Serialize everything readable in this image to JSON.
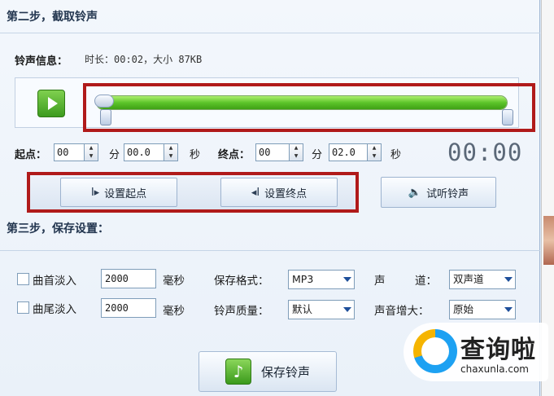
{
  "step2": {
    "title": "第二步，截取铃声",
    "info_label": "铃声信息：",
    "info_value": "时长：00:02，大小 87KB",
    "range_progress": 1.0
  },
  "time": {
    "start_label": "起点：",
    "start_min": "00",
    "start_min_unit": "分",
    "start_sec": "00.0",
    "start_sec_unit": "秒",
    "end_label": "终点：",
    "end_min": "00",
    "end_min_unit": "分",
    "end_sec": "02.0",
    "end_sec_unit": "秒",
    "display": "00:00"
  },
  "buttons": {
    "set_start": "设置起点",
    "set_end": "设置终点",
    "preview": "试听铃声",
    "save": "保存铃声"
  },
  "step3": {
    "title": "第三步，保存设置：",
    "fade_in_label": "曲首淡入",
    "fade_in_value": "2000",
    "fade_in_unit": "毫秒",
    "fade_out_label": "曲尾淡入",
    "fade_out_value": "2000",
    "fade_out_unit": "毫秒",
    "format_label": "保存格式：",
    "format_value": "MP3",
    "quality_label": "铃声质量：",
    "quality_value": "默认",
    "channel_label_1": "声",
    "channel_label_2": "道：",
    "channel_value": "双声道",
    "gain_label": "声音增大：",
    "gain_value": "原始"
  },
  "watermark": {
    "brand": "查询啦",
    "url": "chaxunla.com"
  },
  "colors": {
    "track_green": "#5cc42a",
    "highlight_red": "#b01a1a",
    "panel_bg": "#eaf1f9"
  }
}
